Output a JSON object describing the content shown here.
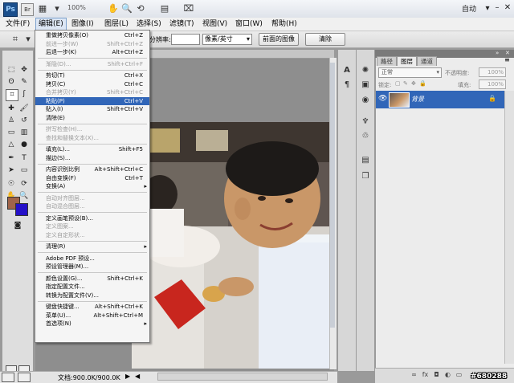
{
  "app": {
    "logo": "Ps",
    "bridge_logo": "Br",
    "zoom": "100%",
    "workspace": "自动"
  },
  "menubar": [
    "文件(F)",
    "编辑(E)",
    "图像(I)",
    "图层(L)",
    "选择(S)",
    "滤镜(T)",
    "视图(V)",
    "窗口(W)",
    "帮助(H)"
  ],
  "options": {
    "resolution_label": "分辨率:",
    "unit": "像素/英寸",
    "front_image": "前面的图像",
    "clear": "清除"
  },
  "edit_menu": {
    "items": [
      {
        "label": "重做拷贝像素(O)",
        "shortcut": "Ctrl+Z",
        "disabled": false
      },
      {
        "label": "前进一步(W)",
        "shortcut": "Shift+Ctrl+Z",
        "disabled": true
      },
      {
        "label": "后退一步(K)",
        "shortcut": "Alt+Ctrl+Z",
        "disabled": false
      },
      {
        "label": "渐隐(D)...",
        "shortcut": "Shift+Ctrl+F",
        "disabled": true
      },
      {
        "label": "剪切(T)",
        "shortcut": "Ctrl+X",
        "disabled": false
      },
      {
        "label": "拷贝(C)",
        "shortcut": "Ctrl+C",
        "disabled": false
      },
      {
        "label": "合并拷贝(Y)",
        "shortcut": "Shift+Ctrl+C",
        "disabled": true
      },
      {
        "label": "粘贴(P)",
        "shortcut": "Ctrl+V",
        "disabled": false,
        "highlighted": true
      },
      {
        "label": "贴入(I)",
        "shortcut": "Shift+Ctrl+V",
        "disabled": false
      },
      {
        "label": "清除(E)",
        "shortcut": "",
        "disabled": false
      },
      {
        "label": "拼写检查(H)...",
        "shortcut": "",
        "disabled": true
      },
      {
        "label": "查找和替换文本(X)...",
        "shortcut": "",
        "disabled": true
      },
      {
        "label": "填充(L)...",
        "shortcut": "Shift+F5",
        "disabled": false
      },
      {
        "label": "描边(S)...",
        "shortcut": "",
        "disabled": false
      },
      {
        "label": "内容识别比例",
        "shortcut": "Alt+Shift+Ctrl+C",
        "disabled": false
      },
      {
        "label": "自由变换(F)",
        "shortcut": "Ctrl+T",
        "disabled": false
      },
      {
        "label": "变换(A)",
        "shortcut": "",
        "disabled": false,
        "submenu": true
      },
      {
        "label": "自动对齐图层...",
        "shortcut": "",
        "disabled": true
      },
      {
        "label": "自动混合图层...",
        "shortcut": "",
        "disabled": true
      },
      {
        "label": "定义画笔预设(B)...",
        "shortcut": "",
        "disabled": false
      },
      {
        "label": "定义图案...",
        "shortcut": "",
        "disabled": true
      },
      {
        "label": "定义自定形状...",
        "shortcut": "",
        "disabled": true
      },
      {
        "label": "清理(R)",
        "shortcut": "",
        "disabled": false,
        "submenu": true
      },
      {
        "label": "Adobe PDF 预设...",
        "shortcut": "",
        "disabled": false
      },
      {
        "label": "预设管理器(M)...",
        "shortcut": "",
        "disabled": false
      },
      {
        "label": "颜色设置(G)...",
        "shortcut": "Shift+Ctrl+K",
        "disabled": false
      },
      {
        "label": "指定配置文件...",
        "shortcut": "",
        "disabled": false
      },
      {
        "label": "转换为配置文件(V)...",
        "shortcut": "",
        "disabled": false
      },
      {
        "label": "键盘快捷键...",
        "shortcut": "Alt+Shift+Ctrl+K",
        "disabled": false
      },
      {
        "label": "菜单(U)...",
        "shortcut": "Alt+Shift+Ctrl+M",
        "disabled": false
      },
      {
        "label": "首选项(N)",
        "shortcut": "",
        "disabled": false,
        "submenu": true
      }
    ]
  },
  "layers_panel": {
    "tabs": [
      "路径",
      "图层",
      "通道"
    ],
    "blend_mode": "正常",
    "opacity_label": "不透明度:",
    "opacity": "100%",
    "lock_label": "锁定:",
    "fill_label": "填充:",
    "fill": "100%",
    "layer_name": "背景"
  },
  "status": {
    "doc": "文档:900.0K/900.0K"
  },
  "watermark": "#680288",
  "colors": {
    "foreground": "#a0644a",
    "background": "#2410c8",
    "highlight": "#3166b8"
  }
}
